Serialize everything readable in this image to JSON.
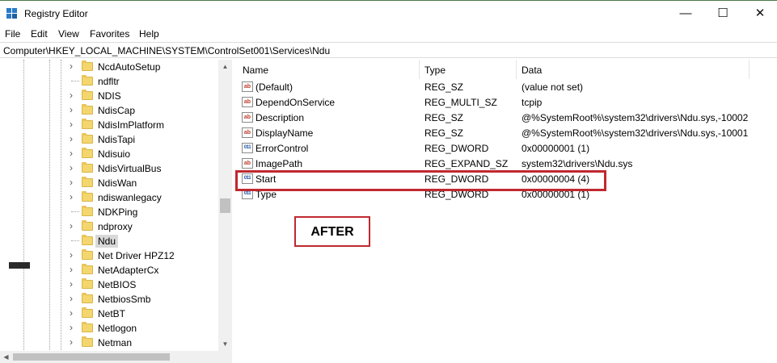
{
  "window": {
    "title": "Registry Editor",
    "minimize_glyph": "—",
    "maximize_glyph": "☐",
    "close_glyph": "✕",
    "icon": "registry-editor-icon"
  },
  "menu": [
    "File",
    "Edit",
    "View",
    "Favorites",
    "Help"
  ],
  "address": "Computer\\HKEY_LOCAL_MACHINE\\SYSTEM\\ControlSet001\\Services\\Ndu",
  "tree": {
    "items": [
      {
        "label": "NcdAutoSetup",
        "expandable": true
      },
      {
        "label": "ndfltr",
        "expandable": false
      },
      {
        "label": "NDIS",
        "expandable": true
      },
      {
        "label": "NdisCap",
        "expandable": true
      },
      {
        "label": "NdisImPlatform",
        "expandable": true
      },
      {
        "label": "NdisTapi",
        "expandable": true
      },
      {
        "label": "Ndisuio",
        "expandable": true
      },
      {
        "label": "NdisVirtualBus",
        "expandable": true
      },
      {
        "label": "NdisWan",
        "expandable": true
      },
      {
        "label": "ndiswanlegacy",
        "expandable": true
      },
      {
        "label": "NDKPing",
        "expandable": false
      },
      {
        "label": "ndproxy",
        "expandable": true
      },
      {
        "label": "Ndu",
        "expandable": false,
        "selected": true
      },
      {
        "label": "Net Driver HPZ12",
        "expandable": true
      },
      {
        "label": "NetAdapterCx",
        "expandable": true
      },
      {
        "label": "NetBIOS",
        "expandable": true
      },
      {
        "label": "NetbiosSmb",
        "expandable": true
      },
      {
        "label": "NetBT",
        "expandable": true
      },
      {
        "label": "Netlogon",
        "expandable": true
      },
      {
        "label": "Netman",
        "expandable": true
      }
    ]
  },
  "list": {
    "columns": {
      "name": "Name",
      "type": "Type",
      "data": "Data"
    },
    "rows": [
      {
        "name": "(Default)",
        "type": "REG_SZ",
        "data": "(value not set)",
        "icon": "string-value-icon"
      },
      {
        "name": "DependOnService",
        "type": "REG_MULTI_SZ",
        "data": "tcpip",
        "icon": "string-value-icon"
      },
      {
        "name": "Description",
        "type": "REG_SZ",
        "data": "@%SystemRoot%\\system32\\drivers\\Ndu.sys,-10002",
        "icon": "string-value-icon"
      },
      {
        "name": "DisplayName",
        "type": "REG_SZ",
        "data": "@%SystemRoot%\\system32\\drivers\\Ndu.sys,-10001",
        "icon": "string-value-icon"
      },
      {
        "name": "ErrorControl",
        "type": "REG_DWORD",
        "data": "0x00000001 (1)",
        "icon": "binary-value-icon"
      },
      {
        "name": "ImagePath",
        "type": "REG_EXPAND_SZ",
        "data": "system32\\drivers\\Ndu.sys",
        "icon": "string-value-icon"
      },
      {
        "name": "Start",
        "type": "REG_DWORD",
        "data": "0x00000004 (4)",
        "icon": "binary-value-icon"
      },
      {
        "name": "Type",
        "type": "REG_DWORD",
        "data": "0x00000001 (1)",
        "icon": "binary-value-icon"
      }
    ]
  },
  "annotation": {
    "label": "AFTER",
    "color": "#c0292f"
  },
  "icons": {
    "string_glyph": "ab",
    "binary_glyph": "011"
  },
  "colors": {
    "folder": "#f4d66e",
    "selection": "#d9d9d9",
    "scroll_track": "#f0f0f0"
  }
}
